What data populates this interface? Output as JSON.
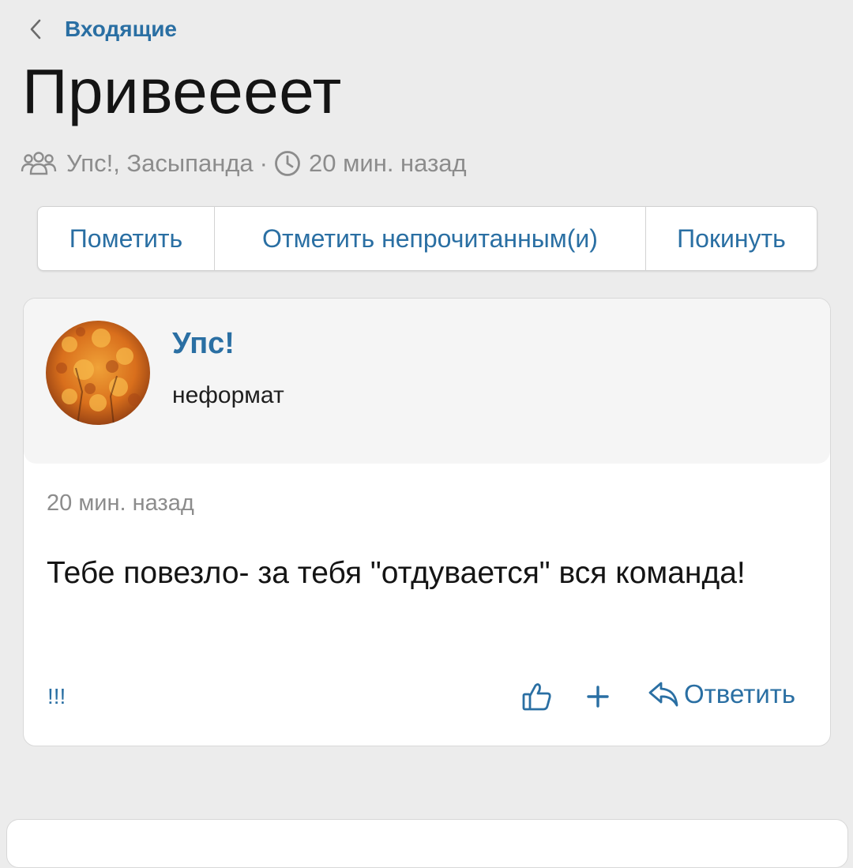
{
  "header": {
    "back_label": "Входящие",
    "title": "Привеееет",
    "participants": "Упс!, Засыпанда",
    "separator": "·",
    "time": "20 мин. назад"
  },
  "actions": {
    "mark": "Пометить",
    "mark_unread": "Отметить непрочитанным(и)",
    "leave": "Покинуть"
  },
  "message": {
    "author": "Упс!",
    "user_title": "неформат",
    "time": "20 мин. назад",
    "body": "Тебе повезло- за тебя \"отдувается\" вся команда!",
    "report_label": "!!!",
    "plus_label": "+",
    "reply_label": "Ответить"
  },
  "colors": {
    "accent": "#2a6fa3",
    "background": "#ececec",
    "muted_text": "#8c8c8c"
  },
  "icons": [
    "chevron-left-icon",
    "users-icon",
    "clock-icon",
    "thumbs-up-icon",
    "reply-icon"
  ]
}
